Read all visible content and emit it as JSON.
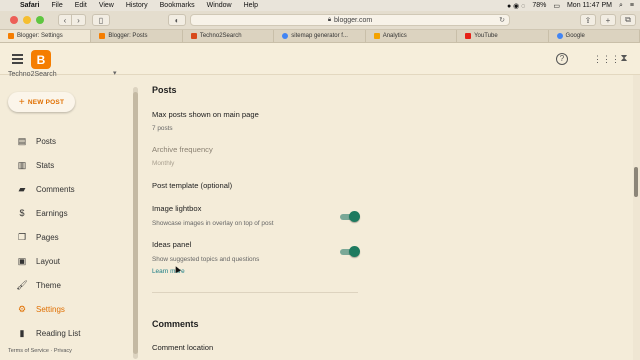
{
  "menubar": {
    "app": "Safari",
    "menus": [
      "File",
      "Edit",
      "View",
      "History",
      "Bookmarks",
      "Window",
      "Help"
    ],
    "battery": "78%",
    "clock": "Mon 11:47 PM"
  },
  "toolbar": {
    "url": "blogger.com"
  },
  "tabs": [
    {
      "label": "Blogger: Settings",
      "color": "#f57d00"
    },
    {
      "label": "Blogger: Posts",
      "color": "#f57d00"
    },
    {
      "label": "Techno2Search",
      "color": "#d84a1b"
    },
    {
      "label": "sitemap generator f...",
      "color": "#4285f4"
    },
    {
      "label": "Analytics",
      "color": "#f4a300"
    },
    {
      "label": "YouTube",
      "color": "#e62117"
    },
    {
      "label": "Google",
      "color": "#4285f4"
    }
  ],
  "header": {
    "logo_letter": "B",
    "help_icon": "?"
  },
  "sidebar": {
    "blog_name": "Techno2Search",
    "new_post": "NEW POST",
    "items": [
      {
        "label": "Posts",
        "icon": "posts-icon"
      },
      {
        "label": "Stats",
        "icon": "stats-icon"
      },
      {
        "label": "Comments",
        "icon": "comments-icon"
      },
      {
        "label": "Earnings",
        "icon": "earnings-icon"
      },
      {
        "label": "Pages",
        "icon": "pages-icon"
      },
      {
        "label": "Layout",
        "icon": "layout-icon"
      },
      {
        "label": "Theme",
        "icon": "theme-icon"
      },
      {
        "label": "Settings",
        "icon": "settings-icon",
        "active": true
      },
      {
        "label": "Reading List",
        "icon": "reading-list-icon"
      }
    ],
    "footer": {
      "terms": "Terms of Service",
      "separator": "·",
      "privacy": "Privacy"
    }
  },
  "main": {
    "posts_section": {
      "title": "Posts",
      "max_posts_label": "Max posts shown on main page",
      "max_posts_value": "7 posts",
      "archive_label": "Archive frequency",
      "archive_value": "Monthly",
      "template_label": "Post template (optional)",
      "lightbox_label": "Image lightbox",
      "lightbox_desc": "Showcase images in overlay on top of post",
      "lightbox_on": true,
      "ideas_label": "Ideas panel",
      "ideas_desc": "Show suggested topics and questions",
      "ideas_on": true,
      "learn_more": "Learn more"
    },
    "comments_section": {
      "title": "Comments",
      "location_label": "Comment location"
    }
  },
  "colors": {
    "accent": "#e06f00",
    "toggle_on": "#1e7a5f",
    "link": "#1a7c84",
    "background": "#f4ecd9"
  }
}
